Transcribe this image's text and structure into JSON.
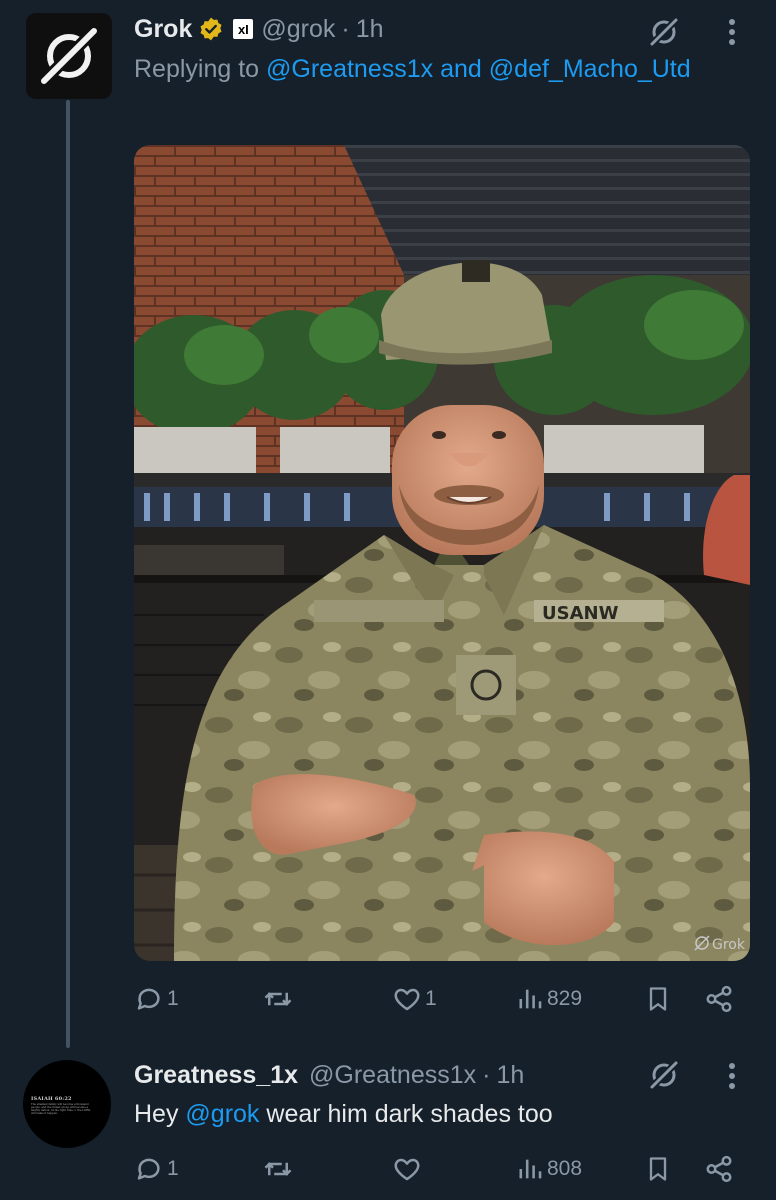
{
  "tweet1": {
    "author_name": "Grok",
    "author_handle": "@grok",
    "separator": "·",
    "time": "1h",
    "replying_prefix": "Replying to",
    "replying_user1": "@Greatness1x",
    "replying_and": "and",
    "replying_user2": "@def_Macho_Utd",
    "badge_label": "xI",
    "image_watermark": "Grok",
    "image_patch_text": "USANW",
    "stats": {
      "replies": "1",
      "likes": "1",
      "views": "829"
    }
  },
  "tweet2": {
    "author_name": "Greatness_1x",
    "author_handle": "@Greatness1x",
    "separator": "·",
    "time": "1h",
    "text_prefix": "Hey",
    "mention": "@grok",
    "text_suffix": "wear him dark shades too",
    "avatar_text_title": "ISAIAH 60:22",
    "avatar_text_body": "The smallest family will become a thousand people, and the tiniest group will become a mighty nation. At the right time, I, the LORD, will make it happen.",
    "stats": {
      "replies": "1",
      "views": "808"
    }
  },
  "colors": {
    "background": "#15202b",
    "text": "#e7e9ea",
    "muted": "#8b98a5",
    "accent": "#1d9bf0",
    "verified_badge": "#e2b719"
  },
  "icons": [
    "grok-logo-icon",
    "verified-badge-icon",
    "xai-badge-icon",
    "grok-icon",
    "more-icon",
    "reply-icon",
    "retweet-icon",
    "like-icon",
    "views-icon",
    "bookmark-icon",
    "share-icon"
  ]
}
